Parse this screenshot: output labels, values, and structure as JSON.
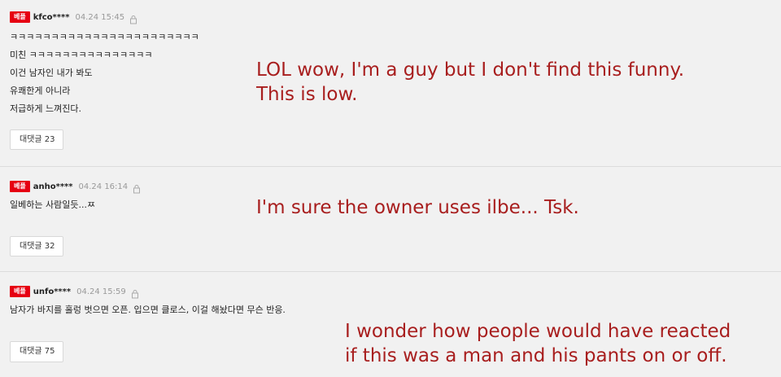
{
  "comments": [
    {
      "badge": "베플",
      "user": "kfco****",
      "date": "04.24 15:45",
      "lines": [
        "ㅋㅋㅋㅋㅋㅋㅋㅋㅋㅋㅋㅋㅋㅋㅋㅋㅋㅋㅋㅋㅋㅋㅋ",
        "미친 ㅋㅋㅋㅋㅋㅋㅋㅋㅋㅋㅋㅋㅋㅋㅋ",
        "이건 남자인 내가 봐도",
        "유쾌한게 아니라",
        "저급하게 느껴진다."
      ],
      "reply_label": "대댓글 23"
    },
    {
      "badge": "베플",
      "user": "anho****",
      "date": "04.24 16:14",
      "lines": [
        "일베하는 사람일듯...ㅉ"
      ],
      "reply_label": "대댓글 32"
    },
    {
      "badge": "베플",
      "user": "unfo****",
      "date": "04.24 15:59",
      "lines": [
        "남자가 바지를 홀렁 벗으면 오픈. 입으면 클로스, 이걸 해놨다면 무슨 반응."
      ],
      "reply_label": "대댓글 75"
    }
  ],
  "captions": [
    [
      "LOL wow, I'm a guy but I don't find this funny.",
      "This is low."
    ],
    [
      "I'm sure the owner uses ilbe... Tsk."
    ],
    [
      "I wonder how people would have reacted",
      "if this was a man and his pants on or off."
    ]
  ],
  "icons": {
    "lock": "lock-icon"
  },
  "colors": {
    "badge": "#e60012",
    "caption": "#a81e1e",
    "background": "#f1f1f1"
  }
}
